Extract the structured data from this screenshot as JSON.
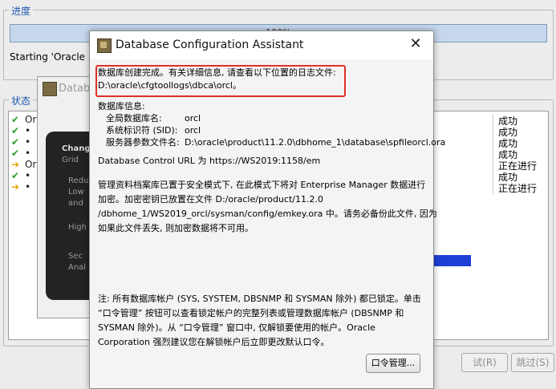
{
  "background_window": {
    "progress_group_label": "进度",
    "progress_text": "100%",
    "progress_percent": 100,
    "starting_text": "Starting 'Oracle Da",
    "status_group_label": "状态",
    "status_rows": [
      {
        "icon": "check-icon",
        "name": "Ora",
        "state": "成功"
      },
      {
        "icon": "check-icon",
        "name": "•",
        "state": "成功"
      },
      {
        "icon": "check-icon",
        "name": "•",
        "state": "成功"
      },
      {
        "icon": "check-icon",
        "name": "•",
        "state": "成功"
      },
      {
        "icon": "arrow-icon",
        "name": "Ora",
        "state": "正在进行"
      },
      {
        "icon": "check-icon",
        "name": "•",
        "state": "成功"
      },
      {
        "icon": "arrow-icon",
        "name": "•",
        "state": "正在进行"
      }
    ],
    "buttons": {
      "retry": "试(R)",
      "skip": "跳过(S)"
    }
  },
  "middle_window": {
    "title": "Datab",
    "panel_lines": [
      "Chang",
      "Grid",
      "Redu",
      "Low",
      "and",
      "High",
      "Sec",
      "Anal"
    ]
  },
  "dialog": {
    "title": "Database Configuration Assistant",
    "close_icon": "close-icon",
    "complete_msg": "数据库创建完成。有关详细信息, 请查看以下位置的日志文件:",
    "log_path": "D:\\oracle\\cfgtoollogs\\dbca\\orcl。",
    "db_info_label": "数据库信息:",
    "global_db_name_label": "全局数据库名:",
    "global_db_name": "orcl",
    "sid_label": "系统标识符 (SID):",
    "sid": "orcl",
    "spfile_label": "服务器参数文件名:",
    "spfile": "D:\\oracle\\product\\11.2.0\\dbhome_1\\database\\spfileorcl.ora",
    "db_control_url": "Database Control URL 为 https://WS2019:1158/em",
    "em_lines": [
      "管理资料档案库已置于安全模式下, 在此模式下将对 Enterprise Manager 数据进行",
      "加密。加密密钥已放置在文件 D:/oracle/product/11.2.0",
      "/dbhome_1/WS2019_orcl/sysman/config/emkey.ora 中。请务必备份此文件, 因为",
      "如果此文件丢失, 则加密数据将不可用。"
    ],
    "note_lines": [
      "注: 所有数据库帐户 (SYS, SYSTEM, DBSNMP 和 SYSMAN 除外) 都已锁定。单击",
      "“口令管理” 按钮可以查看锁定帐户的完整列表或管理数据库帐户 (DBSNMP 和",
      "SYSMAN 除外)。从 “口令管理” 窗口中, 仅解锁要使用的帐户。Oracle",
      "Corporation 强烈建议您在解锁帐户后立即更改默认口令。"
    ],
    "password_button": "口令管理...",
    "highlight_color": "#e0302a"
  }
}
